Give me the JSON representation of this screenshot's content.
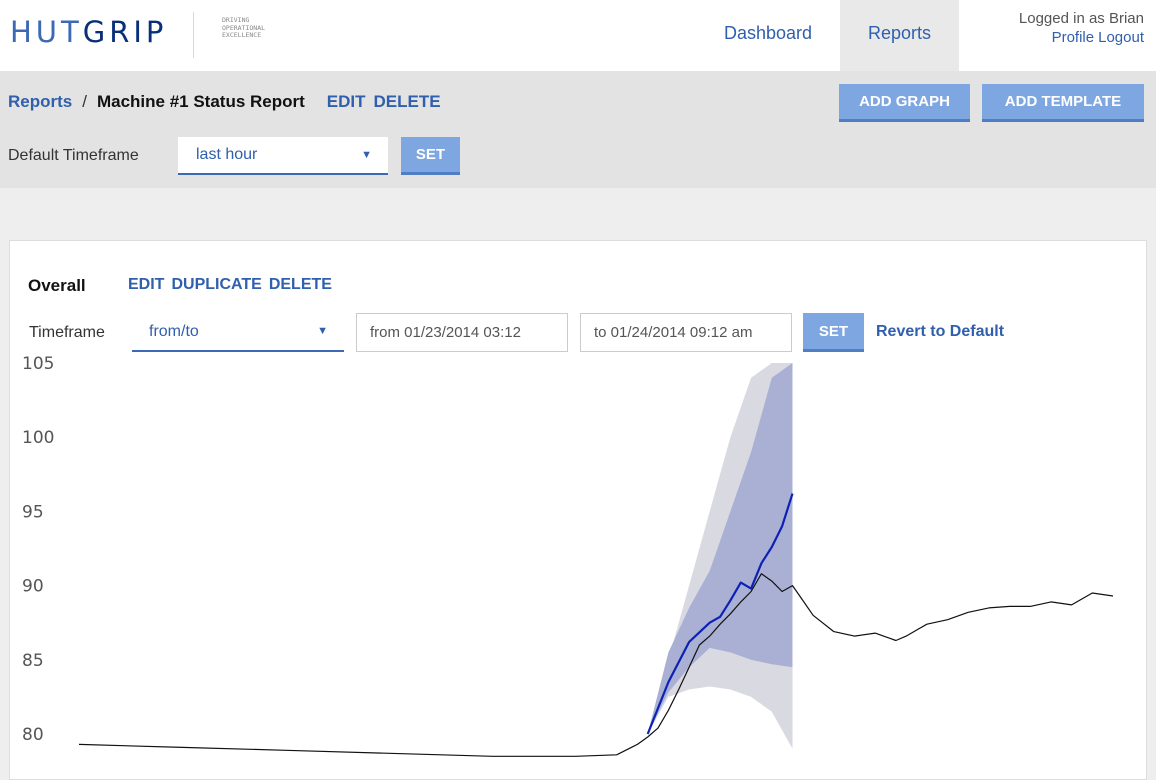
{
  "app": {
    "logo_main": "HUT",
    "logo_accent": "GRIP",
    "tagline": "DRIVING\nOPERATIONAL\nEXCELLENCE"
  },
  "nav": {
    "dashboard": "Dashboard",
    "reports": "Reports",
    "active": "Reports"
  },
  "user": {
    "logged_in_text": "Logged in as Brian",
    "profile": "Profile",
    "logout": "Logout"
  },
  "breadcrumb": {
    "parent": "Reports",
    "separator": "/",
    "current": "Machine #1 Status Report",
    "edit": "EDIT",
    "delete": "DELETE"
  },
  "toolbar": {
    "add_graph": "ADD GRAPH",
    "add_template": "ADD TEMPLATE",
    "default_timeframe_label": "Default Timeframe",
    "default_timeframe_value": "last hour",
    "set": "SET"
  },
  "panel": {
    "title": "Overall",
    "edit": "EDIT",
    "duplicate": "DUPLICATE",
    "delete": "DELETE",
    "timeframe_label": "Timeframe",
    "timeframe_value": "from/to",
    "from_value": "from 01/23/2014 03:12",
    "to_value": "to 01/24/2014 09:12 am",
    "set": "SET",
    "revert": "Revert to Default"
  },
  "colors": {
    "accent": "#2f5fad",
    "button": "#7ea6e0",
    "forecast_line": "#0d22b5",
    "inner_band": "#a9b0d3",
    "outer_band": "#d9d9e1"
  },
  "chart_data": {
    "type": "line",
    "ylim": [
      79,
      105
    ],
    "yticks": [
      "105",
      "100",
      "95",
      "90",
      "85",
      "80"
    ],
    "yticks_values": [
      105,
      100,
      95,
      90,
      85,
      80
    ],
    "series": [
      {
        "role": "actual",
        "x": [
          0,
          10,
          20,
          30,
          40,
          48,
          52,
          54,
          55,
          56,
          57,
          58,
          59,
          60,
          61,
          62,
          63,
          64,
          65,
          66,
          67,
          68,
          69,
          70,
          71,
          73,
          75,
          77,
          79,
          80,
          81,
          82,
          84,
          86,
          88,
          90,
          92,
          94,
          96,
          98,
          100
        ],
        "values": [
          79.3,
          79.1,
          78.9,
          78.7,
          78.5,
          78.5,
          78.6,
          79.3,
          79.8,
          80.4,
          81.6,
          83.0,
          84.5,
          86.0,
          86.6,
          87.4,
          88.1,
          88.9,
          89.6,
          90.8,
          90.3,
          89.6,
          90.0,
          89.0,
          88.0,
          86.9,
          86.6,
          86.8,
          86.3,
          86.6,
          87.0,
          87.4,
          87.7,
          88.2,
          88.5,
          88.6,
          88.6,
          88.9,
          88.7,
          89.5,
          89.3
        ]
      },
      {
        "role": "forecast",
        "x": [
          55,
          57,
          59,
          61,
          62,
          63,
          64,
          65,
          66,
          67,
          68,
          69
        ],
        "values": [
          80.0,
          83.5,
          86.2,
          87.5,
          87.9,
          89.0,
          90.2,
          89.8,
          91.5,
          92.6,
          94.0,
          96.2
        ]
      }
    ],
    "bands": [
      {
        "role": "outer",
        "x": [
          55,
          57,
          59,
          61,
          63,
          65,
          67,
          69
        ],
        "upper": [
          80.0,
          85.0,
          90.0,
          95.0,
          100.0,
          104.0,
          105.0,
          105.0
        ],
        "lower": [
          80.0,
          82.5,
          83.0,
          83.2,
          83.0,
          82.5,
          81.5,
          79.0
        ]
      },
      {
        "role": "inner",
        "x": [
          55,
          57,
          59,
          61,
          63,
          65,
          67,
          69
        ],
        "upper": [
          80.0,
          85.5,
          88.5,
          91.0,
          95.0,
          99.0,
          104.0,
          105.0
        ],
        "lower": [
          80.0,
          82.8,
          84.5,
          85.8,
          85.5,
          85.0,
          84.7,
          84.5
        ]
      }
    ]
  }
}
